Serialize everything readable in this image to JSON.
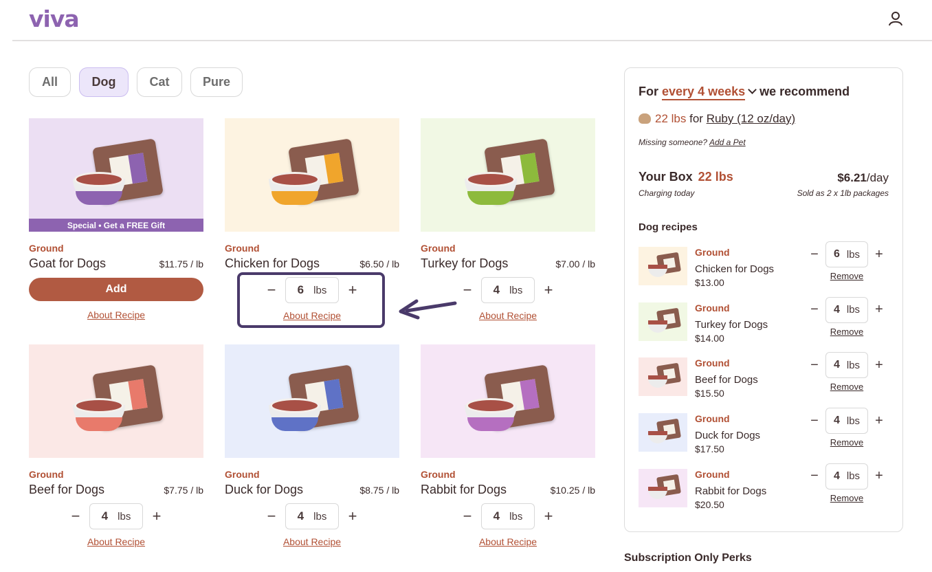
{
  "header": {
    "logo": "viva",
    "account_icon": "user-icon"
  },
  "filters": [
    {
      "label": "All",
      "active": false
    },
    {
      "label": "Dog",
      "active": true
    },
    {
      "label": "Cat",
      "active": false
    },
    {
      "label": "Pure",
      "active": false
    }
  ],
  "products": [
    {
      "tag": "Ground",
      "name": "Goat for Dogs",
      "price": "$11.75 / lb",
      "bg": "#ecdff3",
      "accent": "#8d63b0",
      "special": "Special • Get a FREE Gift",
      "add_label": "Add",
      "about": "About Recipe"
    },
    {
      "tag": "Ground",
      "name": "Chicken for Dogs",
      "price": "$6.50 / lb",
      "bg": "#fdf3e1",
      "accent": "#f0a52c",
      "qty": "6",
      "unit": "lbs",
      "about": "About Recipe"
    },
    {
      "tag": "Ground",
      "name": "Turkey for Dogs",
      "price": "$7.00 / lb",
      "bg": "#f1f8e4",
      "accent": "#8dba3c",
      "qty": "4",
      "unit": "lbs",
      "about": "About Recipe"
    },
    {
      "tag": "Ground",
      "name": "Beef for Dogs",
      "price": "$7.75 / lb",
      "bg": "#fbe8e6",
      "accent": "#e87a6b",
      "qty": "4",
      "unit": "lbs",
      "about": "About Recipe"
    },
    {
      "tag": "Ground",
      "name": "Duck for Dogs",
      "price": "$8.75 / lb",
      "bg": "#e8edfb",
      "accent": "#5f72c6",
      "qty": "4",
      "unit": "lbs",
      "about": "About Recipe"
    },
    {
      "tag": "Ground",
      "name": "Rabbit for Dogs",
      "price": "$10.25 / lb",
      "bg": "#f6e6f6",
      "accent": "#b56fc0",
      "qty": "4",
      "unit": "lbs",
      "about": "About Recipe"
    }
  ],
  "panel": {
    "for": "For",
    "frequency": "every 4 weeks",
    "recommend": "we recommend",
    "pet_lbs": "22 lbs",
    "pet_for": "for",
    "pet_name": "Ruby (12 oz/day)",
    "missing": "Missing someone?",
    "add_pet": "Add a Pet",
    "your_box": "Your Box",
    "box_lbs": "22 lbs",
    "per_day_value": "$6.21",
    "per_day_unit": "/day",
    "charging": "Charging today",
    "sold_as": "Sold as 2 x 1lb packages",
    "recipes_title": "Dog recipes",
    "recipes": [
      {
        "tag": "Ground",
        "name": "Chicken for Dogs",
        "price": "$13.00",
        "qty": "6",
        "unit": "lbs",
        "remove": "Remove",
        "bg": "#fdf3e1"
      },
      {
        "tag": "Ground",
        "name": "Turkey for Dogs",
        "price": "$14.00",
        "qty": "4",
        "unit": "lbs",
        "remove": "Remove",
        "bg": "#f1f8e4"
      },
      {
        "tag": "Ground",
        "name": "Beef for Dogs",
        "price": "$15.50",
        "qty": "4",
        "unit": "lbs",
        "remove": "Remove",
        "bg": "#fbe8e6"
      },
      {
        "tag": "Ground",
        "name": "Duck for Dogs",
        "price": "$17.50",
        "qty": "4",
        "unit": "lbs",
        "remove": "Remove",
        "bg": "#e8edfb"
      },
      {
        "tag": "Ground",
        "name": "Rabbit for Dogs",
        "price": "$20.50",
        "qty": "4",
        "unit": "lbs",
        "remove": "Remove",
        "bg": "#f6e6f6"
      }
    ]
  },
  "perks_title": "Subscription Only Perks",
  "stepper": {
    "minus": "−",
    "plus": "+"
  }
}
